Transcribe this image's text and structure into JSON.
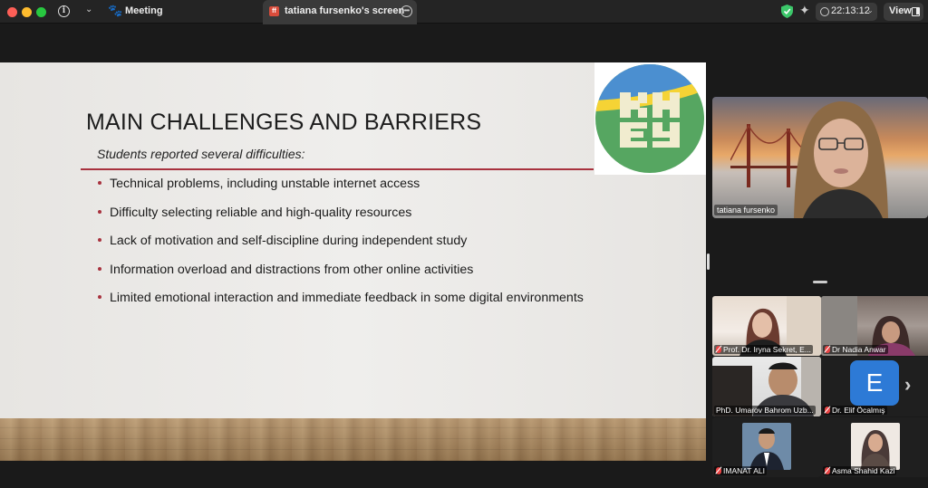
{
  "topbar": {
    "meeting_label": "Meeting",
    "screen_tab_label": "tatiana fursenko's screen",
    "clock": "22:13:12",
    "view_label": "View",
    "colors": {
      "close": "#fe5f57",
      "minimize": "#febc2e",
      "zoom": "#28c840",
      "shield": "#3cc76a"
    }
  },
  "slide": {
    "title": "MAIN CHALLENGES AND BARRIERS",
    "subtitle": "Students reported several difficulties:",
    "bullets": [
      "Technical problems, including unstable internet access",
      "Difficulty selecting reliable and high-quality resources",
      "Lack of motivation and self-discipline during independent study",
      "Information overload and distractions from other online activities",
      "Limited emotional interaction and immediate feedback in some digital environments"
    ],
    "accent_color": "#a8323e",
    "logo": {
      "colors": {
        "green": "#56a661",
        "yellow": "#f5d335",
        "blue": "#4b8fd0",
        "letters": "#f1eccf"
      }
    }
  },
  "speaker": {
    "name": "tatiana fursenko"
  },
  "participants": [
    {
      "name": "Prof. Dr. Iryna Sekret, E...",
      "muted": true
    },
    {
      "name": "Dr Nadia Anwar",
      "muted": true
    },
    {
      "name": "PhD. Umarov Bahrom Uzb...",
      "muted": false
    },
    {
      "name": "Dr. Elif Öcalmış",
      "muted": true,
      "avatar_letter": "E"
    },
    {
      "name": "IMANAT ALI",
      "muted": true
    },
    {
      "name": "Asma Shahid Kazi",
      "muted": true
    }
  ]
}
